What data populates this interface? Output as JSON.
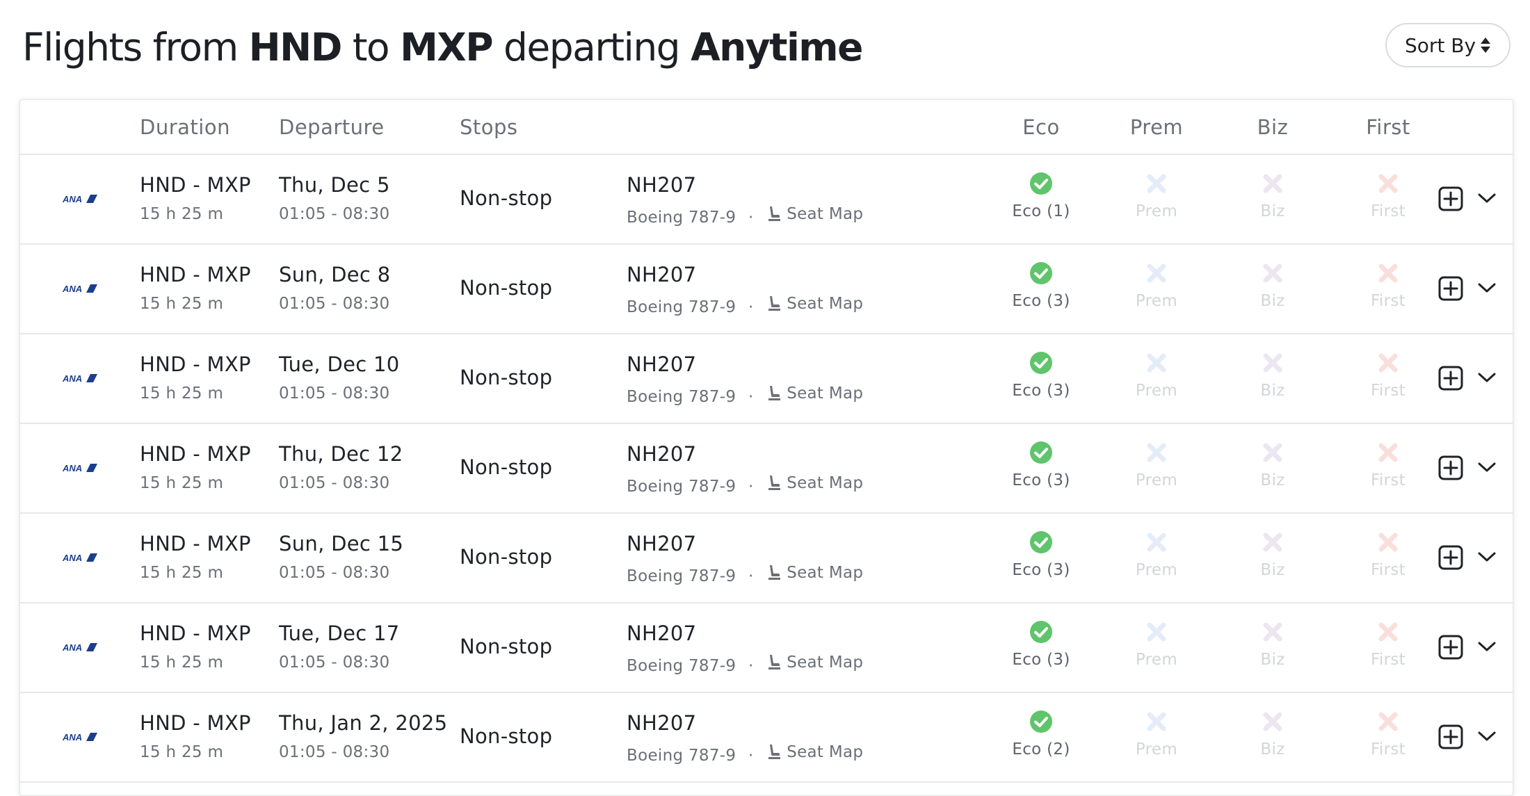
{
  "header": {
    "title_prefix": "Flights from ",
    "origin": "HND",
    "to_word": " to ",
    "destination": "MXP",
    "departing_word": " departing ",
    "when": "Anytime",
    "sort_label": "Sort By"
  },
  "columns": {
    "duration": "Duration",
    "departure": "Departure",
    "stops": "Stops",
    "eco": "Eco",
    "prem": "Prem",
    "biz": "Biz",
    "first": "First"
  },
  "colors": {
    "available": "#5fc46b",
    "prem_unavailable": "#e4ecf7",
    "biz_unavailable": "#ece6f1",
    "first_unavailable": "#f9dfdc",
    "airline_logo": "#1b3e8c"
  },
  "flights": [
    {
      "airline_logo": "ANA",
      "route": "HND - MXP",
      "duration": "15 h 25 m",
      "date": "Thu, Dec 5",
      "times": "01:05 - 08:30",
      "stops": "Non-stop",
      "flight_no": "NH207",
      "aircraft": "Boeing 787-9",
      "sep": "·",
      "seat_map": "Seat Map",
      "eco": "Eco (1)",
      "prem": "Prem",
      "biz": "Biz",
      "first": "First"
    },
    {
      "airline_logo": "ANA",
      "route": "HND - MXP",
      "duration": "15 h 25 m",
      "date": "Sun, Dec 8",
      "times": "01:05 - 08:30",
      "stops": "Non-stop",
      "flight_no": "NH207",
      "aircraft": "Boeing 787-9",
      "sep": "·",
      "seat_map": "Seat Map",
      "eco": "Eco (3)",
      "prem": "Prem",
      "biz": "Biz",
      "first": "First"
    },
    {
      "airline_logo": "ANA",
      "route": "HND - MXP",
      "duration": "15 h 25 m",
      "date": "Tue, Dec 10",
      "times": "01:05 - 08:30",
      "stops": "Non-stop",
      "flight_no": "NH207",
      "aircraft": "Boeing 787-9",
      "sep": "·",
      "seat_map": "Seat Map",
      "eco": "Eco (3)",
      "prem": "Prem",
      "biz": "Biz",
      "first": "First"
    },
    {
      "airline_logo": "ANA",
      "route": "HND - MXP",
      "duration": "15 h 25 m",
      "date": "Thu, Dec 12",
      "times": "01:05 - 08:30",
      "stops": "Non-stop",
      "flight_no": "NH207",
      "aircraft": "Boeing 787-9",
      "sep": "·",
      "seat_map": "Seat Map",
      "eco": "Eco (3)",
      "prem": "Prem",
      "biz": "Biz",
      "first": "First"
    },
    {
      "airline_logo": "ANA",
      "route": "HND - MXP",
      "duration": "15 h 25 m",
      "date": "Sun, Dec 15",
      "times": "01:05 - 08:30",
      "stops": "Non-stop",
      "flight_no": "NH207",
      "aircraft": "Boeing 787-9",
      "sep": "·",
      "seat_map": "Seat Map",
      "eco": "Eco (3)",
      "prem": "Prem",
      "biz": "Biz",
      "first": "First"
    },
    {
      "airline_logo": "ANA",
      "route": "HND - MXP",
      "duration": "15 h 25 m",
      "date": "Tue, Dec 17",
      "times": "01:05 - 08:30",
      "stops": "Non-stop",
      "flight_no": "NH207",
      "aircraft": "Boeing 787-9",
      "sep": "·",
      "seat_map": "Seat Map",
      "eco": "Eco (3)",
      "prem": "Prem",
      "biz": "Biz",
      "first": "First"
    },
    {
      "airline_logo": "ANA",
      "route": "HND - MXP",
      "duration": "15 h 25 m",
      "date": "Thu, Jan 2, 2025",
      "times": "01:05 - 08:30",
      "stops": "Non-stop",
      "flight_no": "NH207",
      "aircraft": "Boeing 787-9",
      "sep": "·",
      "seat_map": "Seat Map",
      "eco": "Eco (2)",
      "prem": "Prem",
      "biz": "Biz",
      "first": "First"
    }
  ]
}
